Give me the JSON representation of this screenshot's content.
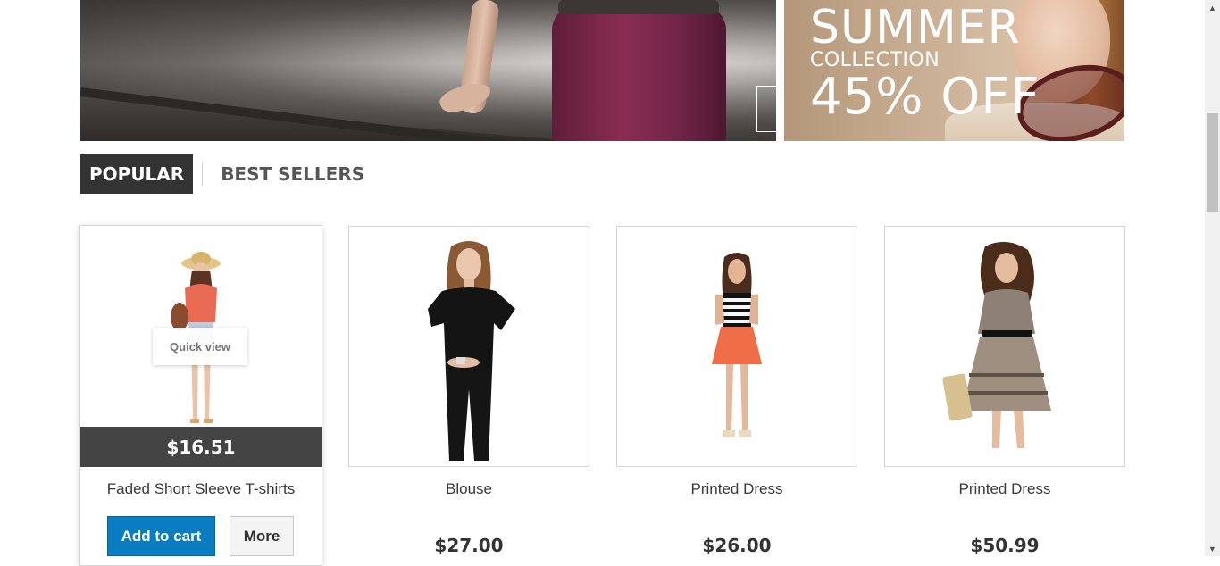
{
  "banner": {
    "slider_prev_icon": "‹",
    "slider_next_icon": "›",
    "promo": {
      "line1": "SUMMER",
      "line2": "COLLECTION",
      "line3": "45% OFF"
    }
  },
  "tabs": [
    {
      "label": "POPULAR",
      "active": true
    },
    {
      "label": "BEST SELLERS",
      "active": false
    }
  ],
  "products": [
    {
      "name": "Faded Short Sleeve T-shirts",
      "price": "$16.51",
      "quick_view": "Quick view",
      "add_to_cart": "Add to cart",
      "more": "More"
    },
    {
      "name": "Blouse",
      "price": "$27.00"
    },
    {
      "name": "Printed Dress",
      "price": "$26.00"
    },
    {
      "name": "Printed Dress",
      "price": "$50.99"
    }
  ],
  "scrollbar": {
    "up_icon": "▲",
    "down_icon": "▼"
  }
}
